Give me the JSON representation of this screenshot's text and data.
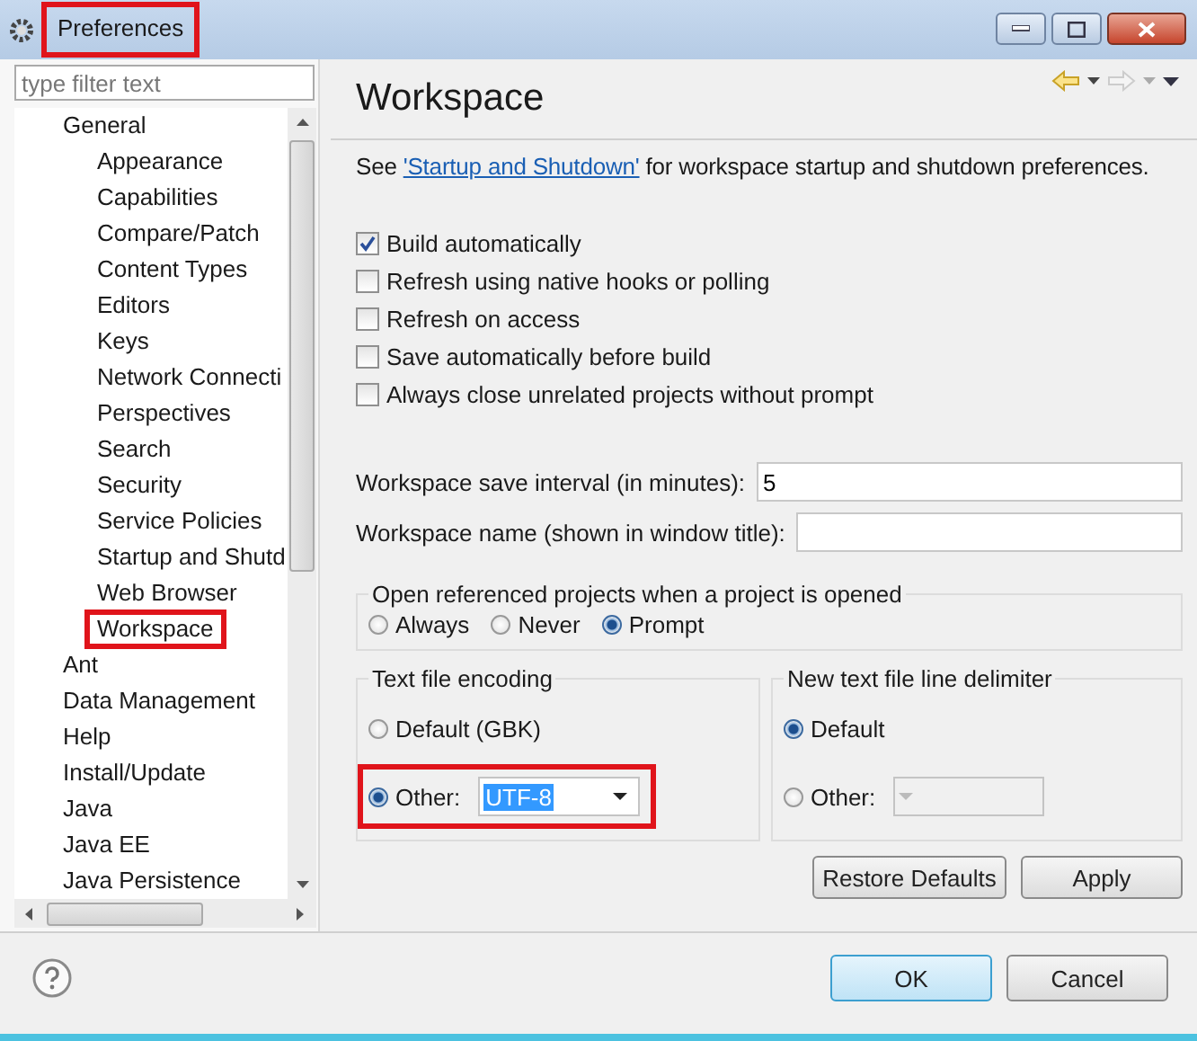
{
  "window": {
    "title": "Preferences",
    "highlighted": true
  },
  "filter": {
    "placeholder": "type filter text"
  },
  "tree": [
    {
      "label": "General",
      "highlighted": false,
      "children": [
        {
          "label": "Appearance",
          "highlighted": false
        },
        {
          "label": "Capabilities",
          "highlighted": false
        },
        {
          "label": "Compare/Patch",
          "highlighted": false
        },
        {
          "label": "Content Types",
          "highlighted": false
        },
        {
          "label": "Editors",
          "highlighted": false
        },
        {
          "label": "Keys",
          "highlighted": false
        },
        {
          "label": "Network Connecti",
          "highlighted": false
        },
        {
          "label": "Perspectives",
          "highlighted": false
        },
        {
          "label": "Search",
          "highlighted": false
        },
        {
          "label": "Security",
          "highlighted": false
        },
        {
          "label": "Service Policies",
          "highlighted": false
        },
        {
          "label": "Startup and Shutd",
          "highlighted": false
        },
        {
          "label": "Web Browser",
          "highlighted": false
        },
        {
          "label": "Workspace",
          "highlighted": true
        }
      ]
    },
    {
      "label": "Ant",
      "highlighted": false
    },
    {
      "label": "Data Management",
      "highlighted": false
    },
    {
      "label": "Help",
      "highlighted": false
    },
    {
      "label": "Install/Update",
      "highlighted": false
    },
    {
      "label": "Java",
      "highlighted": false
    },
    {
      "label": "Java EE",
      "highlighted": false
    },
    {
      "label": "Java Persistence",
      "highlighted": false
    }
  ],
  "page": {
    "title": "Workspace",
    "intro": "See ",
    "link": "'Startup and Shutdown'",
    "intro_rest": " for workspace startup and shutdown preferences."
  },
  "options": [
    {
      "label": "Build automatically",
      "checked": true
    },
    {
      "label": "Refresh using native hooks or polling",
      "checked": false
    },
    {
      "label": "Refresh on access",
      "checked": false
    },
    {
      "label": "Save automatically before build",
      "checked": false
    },
    {
      "label": "Always close unrelated projects without prompt",
      "checked": false
    }
  ],
  "fields": [
    {
      "label": "Workspace save interval (in minutes):",
      "value": "5"
    },
    {
      "label": "Workspace name (shown in window title):"
    }
  ],
  "open_projects": {
    "title": "Open referenced projects when a project is opened",
    "choices": [
      {
        "label": "Always",
        "selected": false
      },
      {
        "label": "Never",
        "selected": false
      },
      {
        "label": "Prompt",
        "selected": true
      }
    ]
  },
  "encoding": {
    "title": "Text file encoding",
    "choices": [
      {
        "label": "Default (GBK)",
        "selected": false,
        "highlighted": false
      },
      {
        "label": "Other:",
        "selected": true,
        "value": "UTF-8",
        "disabled": false,
        "highlighted": true
      }
    ]
  },
  "delimiter": {
    "title": "New text file line delimiter",
    "choices": [
      {
        "label": "Default",
        "selected": true,
        "highlighted": false
      },
      {
        "label": "Other:",
        "selected": false,
        "disabled": true,
        "highlighted": false
      }
    ]
  },
  "page_buttons": [
    "Restore Defaults",
    "Apply"
  ],
  "dialog_buttons": [
    {
      "label": "OK",
      "default": true
    },
    {
      "label": "Cancel",
      "default": false
    }
  ]
}
